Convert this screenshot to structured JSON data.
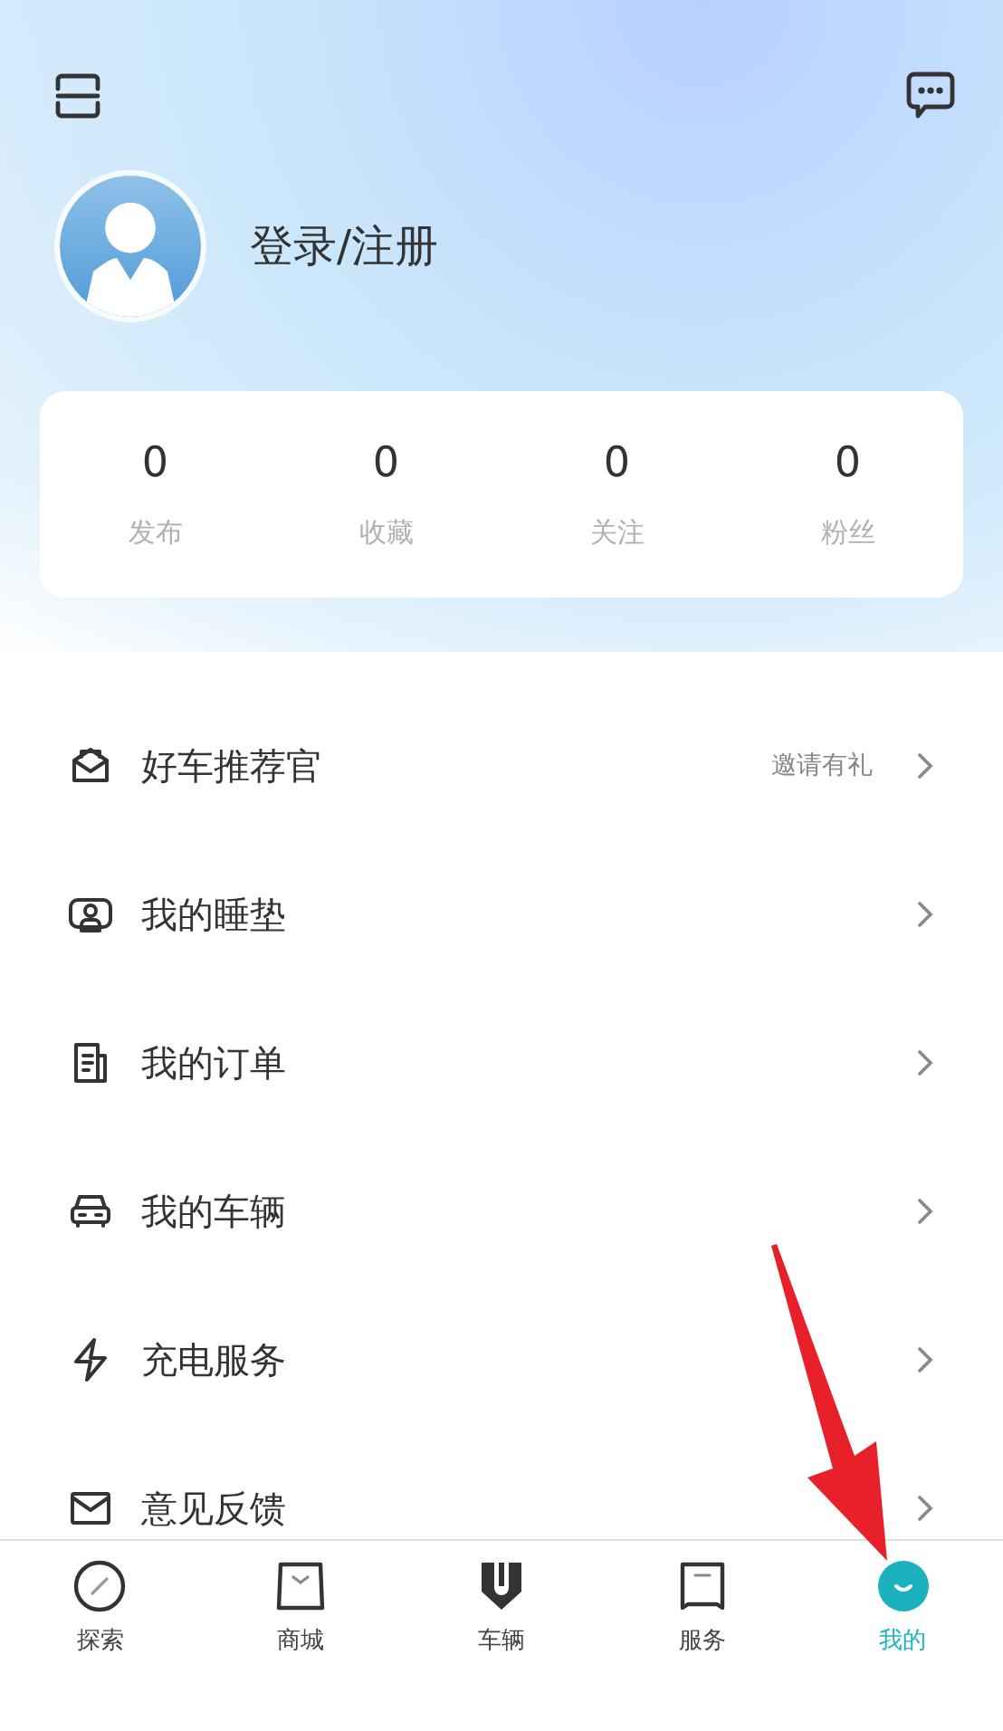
{
  "profile": {
    "login_label": "登录/注册"
  },
  "stats": [
    {
      "value": "0",
      "label": "发布"
    },
    {
      "value": "0",
      "label": "收藏"
    },
    {
      "value": "0",
      "label": "关注"
    },
    {
      "value": "0",
      "label": "粉丝"
    }
  ],
  "menu": [
    {
      "label": "好车推荐官",
      "note": "邀请有礼"
    },
    {
      "label": "我的睡垫"
    },
    {
      "label": "我的订单"
    },
    {
      "label": "我的车辆"
    },
    {
      "label": "充电服务"
    },
    {
      "label": "意见反馈"
    }
  ],
  "tabs": [
    {
      "label": "探索",
      "selected": false
    },
    {
      "label": "商城",
      "selected": false
    },
    {
      "label": "车辆",
      "selected": false
    },
    {
      "label": "服务",
      "selected": false
    },
    {
      "label": "我的",
      "selected": true
    }
  ],
  "annotation": {
    "kind": "arrow"
  }
}
